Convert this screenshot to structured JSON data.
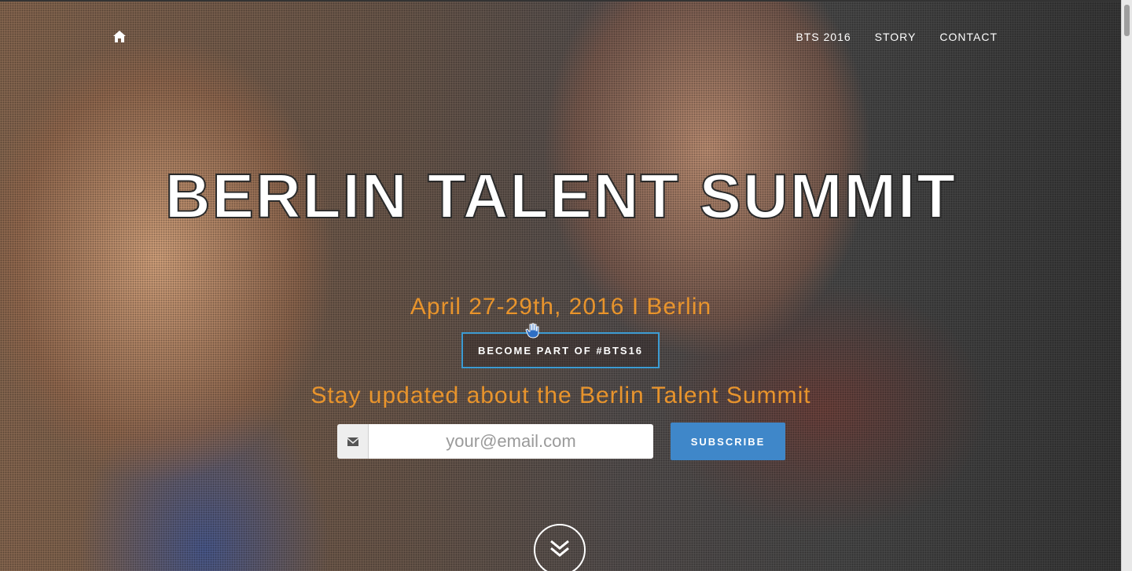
{
  "nav": {
    "home_icon": "home-icon",
    "links": [
      {
        "label": "BTS 2016"
      },
      {
        "label": "STORY"
      },
      {
        "label": "CONTACT"
      }
    ]
  },
  "hero": {
    "title": "BERLIN TALENT SUMMIT",
    "date_line": "April 27-29th, 2016 I Berlin",
    "cta_label": "BECOME PART OF #BTS16",
    "subscribe_heading": "Stay updated about the Berlin Talent Summit",
    "email_icon": "envelope-icon",
    "email_placeholder": "your@email.com",
    "email_value": "",
    "subscribe_label": "SUBSCRIBE",
    "scroll_icon": "double-chevron-down-icon"
  },
  "colors": {
    "accent_orange": "#e8942c",
    "button_blue": "#3f87c9",
    "cta_border": "#3c9bd2"
  }
}
